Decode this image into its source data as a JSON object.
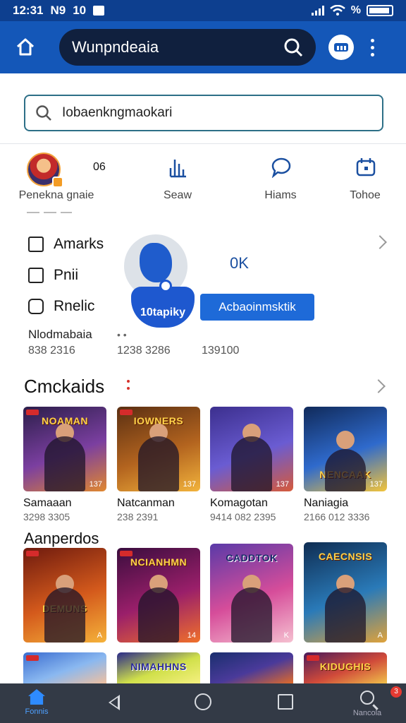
{
  "status": {
    "time": "12:31",
    "carrier": "N9",
    "extra": "10",
    "battery_pct": "%"
  },
  "appbar": {
    "title": "Wunpndeaia"
  },
  "search": {
    "value": "Iobaenkngmaokari"
  },
  "shortcuts": [
    {
      "label": "Penekna gnaie",
      "value": "06"
    },
    {
      "label": "Seaw"
    },
    {
      "label": "Hiams"
    },
    {
      "label": "Tohoe"
    }
  ],
  "menu": {
    "items": [
      "Amarks",
      "Pnii",
      "Rnelic"
    ],
    "ok_text": "0K",
    "follow_label": "10tapiky",
    "action_label": "Acbaoinmsktik",
    "stats_label": "Nlodmabaia",
    "stats": [
      "838 2316",
      "1238 3286",
      "139100"
    ]
  },
  "sections": {
    "first_title": "Cmckaids",
    "second_title": "Aanperdos"
  },
  "games_row1": [
    {
      "name": "Samaaan",
      "sub": "3298 3305",
      "banner": "NOAMAN",
      "corner": "137",
      "bg": [
        "#2b1e4a",
        "#7b3fa0",
        "#e0872f"
      ]
    },
    {
      "name": "Natcanman",
      "sub": "238 2391",
      "banner": "IOWNERS",
      "corner": "137",
      "bg": [
        "#5a2f12",
        "#b3641f",
        "#f2b33c"
      ]
    },
    {
      "name": "Komagotan",
      "sub": "9414 082 2395",
      "banner": "",
      "corner": "137",
      "bg": [
        "#3c2f8e",
        "#6a5cd2",
        "#d65a3a"
      ]
    },
    {
      "name": "Naniagia",
      "sub": "2166 012 3336",
      "banner": "NENCAAK",
      "corner": "137",
      "bg": [
        "#102a5a",
        "#2f6acc",
        "#f3c43a"
      ]
    }
  ],
  "games_row2": [
    {
      "banner": "DEMUNS",
      "corner": "A",
      "bg": [
        "#6e1a0e",
        "#d45a1c",
        "#f5b23a"
      ]
    },
    {
      "banner": "NCIANHMN",
      "corner": "14",
      "bg": [
        "#3a0d3e",
        "#9a1f6a",
        "#f0702a"
      ]
    },
    {
      "banner": "CADDTOK",
      "corner": "K",
      "bg": [
        "#5a3aa8",
        "#d64d9a",
        "#f5c0d0"
      ]
    },
    {
      "banner": "CAECNSIS",
      "corner": "A",
      "bg": [
        "#0f2d52",
        "#2a7ab8",
        "#e0a23a"
      ]
    }
  ],
  "games_row3": [
    {
      "banner": "",
      "bg": [
        "#3a6cd0",
        "#8ab8f0",
        "#f0c0a0"
      ]
    },
    {
      "banner": "NIMAHHNS",
      "bg": [
        "#2a2a8a",
        "#d0e04a",
        "#f5f080"
      ]
    },
    {
      "banner": "",
      "bg": [
        "#1a2f6e",
        "#4a3a9a",
        "#e06a2a"
      ]
    },
    {
      "banner": "KIDUGHIS",
      "bg": [
        "#4a1a5a",
        "#d04a3a",
        "#f0c04a"
      ]
    }
  ],
  "navbar": {
    "home_label": "Fonnis",
    "search_label": "Nancola",
    "badge": "3"
  },
  "colors": {
    "primary": "#1457b8",
    "status": "#0d3f8f",
    "accent": "#1e58cf",
    "nav": "#333a46"
  }
}
